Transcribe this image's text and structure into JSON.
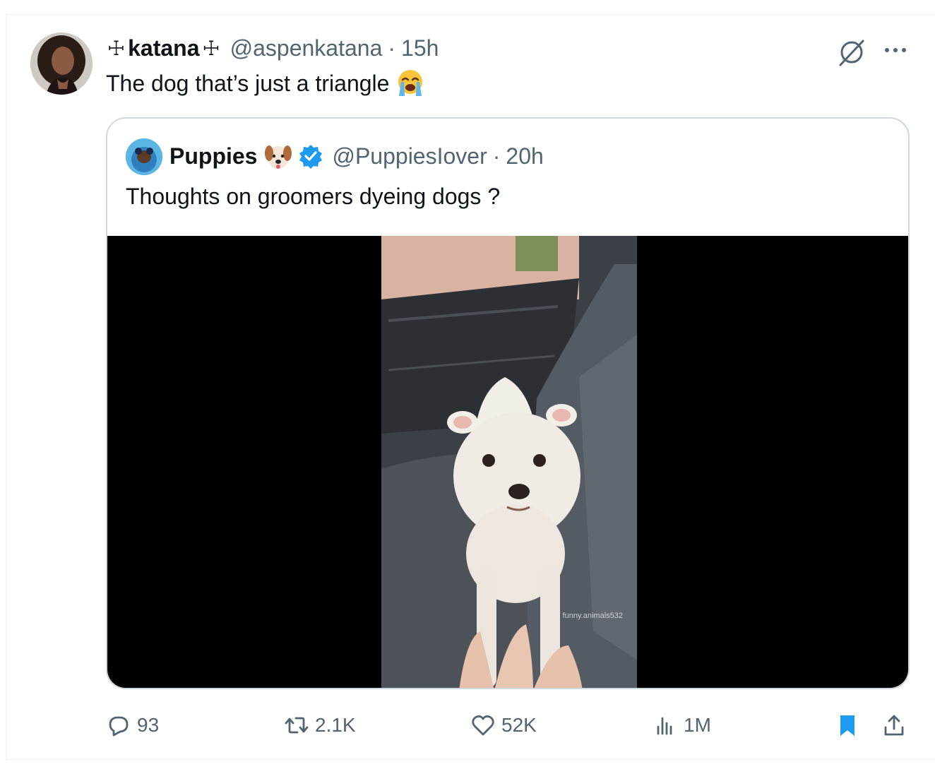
{
  "tweet": {
    "author": {
      "name": "katana",
      "decoration": "☩",
      "handle": "@aspenkatana",
      "separator": "·",
      "time": "15h"
    },
    "text": "The dog that’s just a triangle",
    "emoji": "loudly-crying-face-emoji",
    "icons": {
      "grok": "grok-icon",
      "more": "more-icon"
    }
  },
  "quote": {
    "author": {
      "name": "Puppies",
      "emoji": "dog-face-emoji",
      "verified": true,
      "handle": "@PuppiesIover",
      "separator": "·",
      "time": "20h"
    },
    "text": "Thoughts on groomers dyeing dogs ?",
    "media": {
      "watermark": "funny.animals532"
    }
  },
  "actions": {
    "replies": "93",
    "reposts": "2.1K",
    "likes": "52K",
    "views": "1M"
  },
  "colors": {
    "text": "#0f1419",
    "secondary": "#536471",
    "border": "#cfd9de",
    "accent": "#1d9bf0"
  }
}
